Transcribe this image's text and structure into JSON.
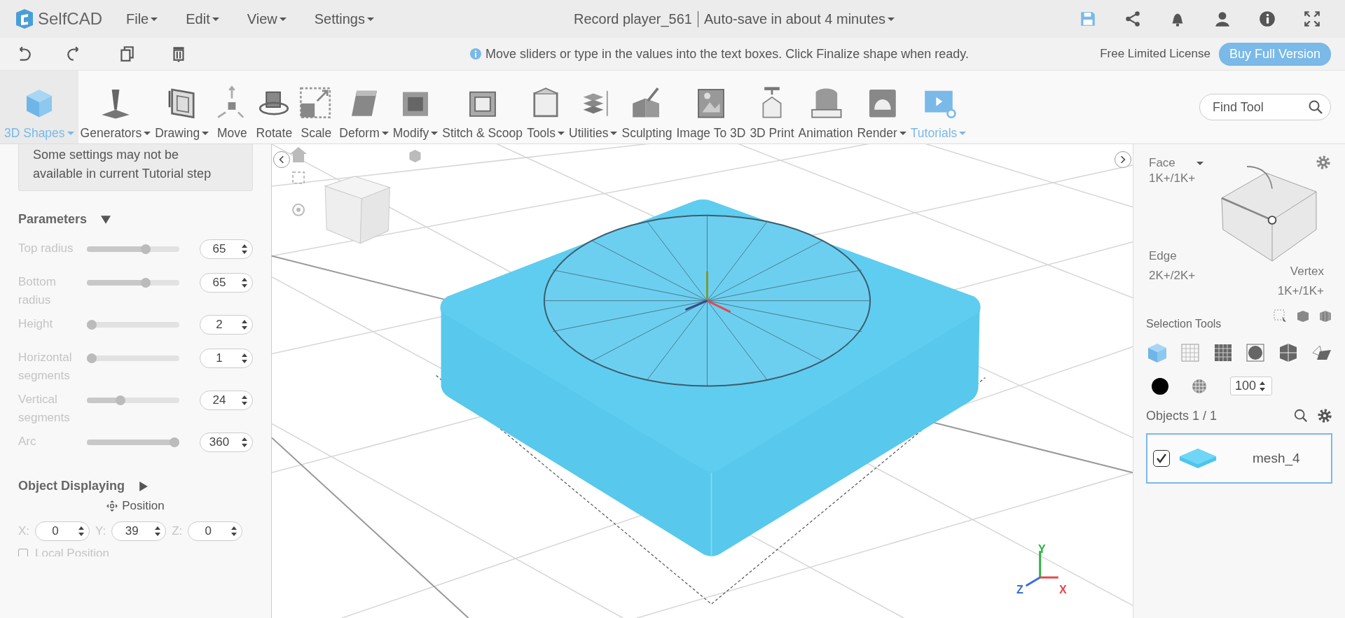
{
  "app": {
    "logo": "SelfCAD",
    "menus": [
      {
        "label": "File"
      },
      {
        "label": "Edit"
      },
      {
        "label": "View"
      },
      {
        "label": "Settings"
      }
    ],
    "document_title": "Record player_561",
    "autosave": "Auto-save in about 4 minutes"
  },
  "hint_bar": {
    "message": "Move sliders or type in the values into the text boxes. Click Finalize shape when ready.",
    "license": "Free Limited License",
    "buy_button": "Buy Full Version"
  },
  "tools": [
    {
      "label": "3D Shapes",
      "dropdown": true,
      "selected": true,
      "highlighted": true
    },
    {
      "label": "Generators",
      "dropdown": true,
      "selected": false,
      "highlighted": false
    },
    {
      "label": "Drawing",
      "dropdown": true,
      "selected": false,
      "highlighted": false
    },
    {
      "label": "Move",
      "dropdown": false,
      "selected": false,
      "highlighted": false
    },
    {
      "label": "Rotate",
      "dropdown": false,
      "selected": false,
      "highlighted": false
    },
    {
      "label": "Scale",
      "dropdown": false,
      "selected": false,
      "highlighted": false
    },
    {
      "label": "Deform",
      "dropdown": true,
      "selected": false,
      "highlighted": false
    },
    {
      "label": "Modify",
      "dropdown": true,
      "selected": false,
      "highlighted": false
    },
    {
      "label": "Stitch & Scoop",
      "dropdown": false,
      "selected": false,
      "highlighted": false
    },
    {
      "label": "Tools",
      "dropdown": true,
      "selected": false,
      "highlighted": false
    },
    {
      "label": "Utilities",
      "dropdown": true,
      "selected": false,
      "highlighted": false
    },
    {
      "label": "Sculpting",
      "dropdown": false,
      "selected": false,
      "highlighted": false
    },
    {
      "label": "Image To 3D",
      "dropdown": false,
      "selected": false,
      "highlighted": false
    },
    {
      "label": "3D Print",
      "dropdown": false,
      "selected": false,
      "highlighted": false
    },
    {
      "label": "Animation",
      "dropdown": false,
      "selected": false,
      "highlighted": false
    },
    {
      "label": "Render",
      "dropdown": true,
      "selected": false,
      "highlighted": false
    },
    {
      "label": "Tutorials",
      "dropdown": true,
      "selected": false,
      "highlighted": true
    }
  ],
  "find_tool": {
    "placeholder": "Find Tool"
  },
  "left_panel": {
    "notice": "Some settings may not be available in current Tutorial step",
    "parameters_title": "Parameters",
    "parameters_expanded": true,
    "parameters": [
      {
        "label": "Top radius",
        "level": 0.65,
        "value": "65"
      },
      {
        "label": "Bottom radius",
        "level": 0.65,
        "value": "65"
      },
      {
        "label": "Height",
        "level": 0.0,
        "value": "2"
      },
      {
        "label": "Horizontal segments",
        "level": 0.0,
        "value": "1"
      },
      {
        "label": "Vertical segments",
        "level": 0.35,
        "value": "24"
      },
      {
        "label": "Arc",
        "level": 1.0,
        "value": "360"
      }
    ],
    "object_displaying_title": "Object Displaying",
    "object_displaying_expanded": false,
    "position_label": "Position",
    "position": [
      {
        "label": "X:",
        "value": "0"
      },
      {
        "label": "Y:",
        "value": "39"
      },
      {
        "label": "Z:",
        "value": "0"
      }
    ],
    "local_position": {
      "label": "Local Position",
      "checked": false
    }
  },
  "viewport": {
    "axes": [
      {
        "label": "Y",
        "color": "#2fb344"
      },
      {
        "label": "Z",
        "color": "#3a6fd8"
      },
      {
        "label": "X",
        "color": "#e5484d"
      }
    ]
  },
  "right_panel": {
    "face": {
      "label": "Face",
      "count": "1K+/1K+"
    },
    "edge": {
      "label": "Edge",
      "count": "2K+/2K+"
    },
    "vertex": {
      "label": "Vertex",
      "count": "1K+/1K+"
    },
    "selection_tools_title": "Selection Tools",
    "opacity": "100",
    "objects_title": "Objects 1 / 1",
    "objects": [
      {
        "name": "mesh_4",
        "checked": true,
        "selected": true
      }
    ]
  }
}
